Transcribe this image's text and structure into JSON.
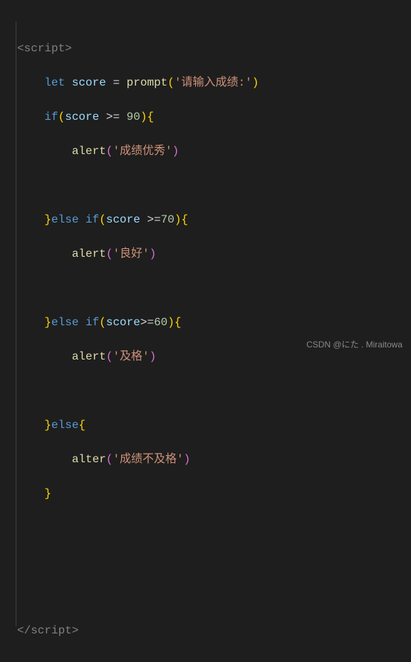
{
  "code": {
    "l1": {
      "open": "<",
      "tag": "script",
      "close": ">"
    },
    "l2": {
      "kw": "let",
      "var": "score",
      "eq": " = ",
      "fn": "prompt",
      "lp": "(",
      "str": "'请输入成绩:'",
      "rp": ")"
    },
    "l3": {
      "kw": "if",
      "lp": "(",
      "var": "score",
      "op": " >= ",
      "num": "90",
      "rp": ")",
      "lb": "{"
    },
    "l4": {
      "fn": "alert",
      "lp": "(",
      "str": "'成绩优秀'",
      "rp": ")"
    },
    "l5": {
      "rb": "}",
      "kw": "else if",
      "lp": "(",
      "var": "score",
      "op": " >=",
      "num": "70",
      "rp": ")",
      "lb": "{"
    },
    "l6": {
      "fn": "alert",
      "lp": "(",
      "str": "'良好'",
      "rp": ")"
    },
    "l7": {
      "rb": "}",
      "kw": "else if",
      "lp": "(",
      "var": "score",
      "op": ">=",
      "num": "60",
      "rp": ")",
      "lb": "{"
    },
    "l8": {
      "fn": "alert",
      "lp": "(",
      "str": "'及格'",
      "rp": ")"
    },
    "l9": {
      "rb": "}",
      "kw": "else",
      "lb": "{"
    },
    "l10": {
      "fn": "alter",
      "lp": "(",
      "str": "'成绩不及格'",
      "rp": ")"
    },
    "l11": {
      "rb": "}"
    },
    "l12": {
      "open": "</",
      "tag": "script",
      "close": ">"
    }
  },
  "watermark": "CSDN @にた . Miraitowa"
}
